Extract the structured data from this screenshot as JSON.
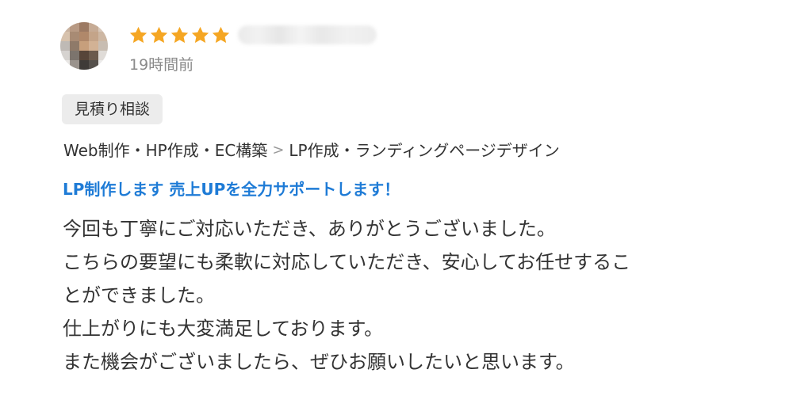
{
  "review": {
    "rating": 5,
    "rating_max": 5,
    "star_color": "#f5a623",
    "timestamp": "19時間前",
    "tag": "見積り相談",
    "breadcrumb": {
      "category": "Web制作・HP作成・EC構築",
      "separator": ">",
      "subcategory": "LP作成・ランディングページデザイン"
    },
    "service_title": "LP制作します 売上UPを全力サポートします！",
    "service_title_color": "#1e7bd6",
    "comment_lines": [
      "今回も丁寧にご対応いただき、ありがとうございました。",
      "こちらの要望にも柔軟に対応していただき、安心してお任せするこ",
      "とができました。",
      "仕上がりにも大変満足しております。",
      "また機会がございましたら、ぜひお願いしたいと思います。"
    ]
  }
}
